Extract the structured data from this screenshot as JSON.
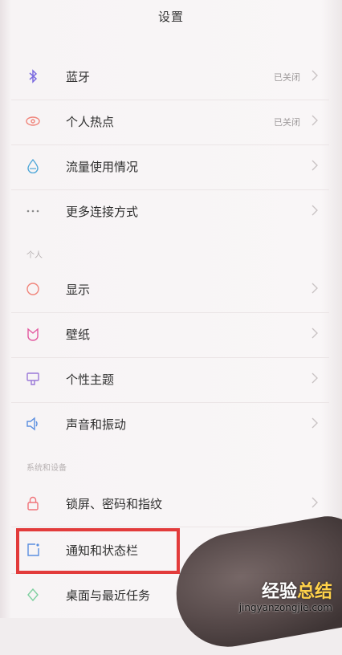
{
  "header": {
    "title": "设置"
  },
  "sections": {
    "personal": "个人",
    "system": "系统和设备"
  },
  "rows": [
    {
      "label": "蓝牙",
      "value": "已关闭",
      "icon": "bluetooth-icon",
      "icon_color": "#7b6be0"
    },
    {
      "label": "个人热点",
      "value": "已关闭",
      "icon": "hotspot-icon",
      "icon_color": "#f0847a"
    },
    {
      "label": "流量使用情况",
      "value": "",
      "icon": "data-usage-icon",
      "icon_color": "#4fa7d8"
    },
    {
      "label": "更多连接方式",
      "value": "",
      "icon": "more-icon",
      "icon_color": "#8a8a8a"
    },
    {
      "label": "显示",
      "value": "",
      "icon": "display-icon",
      "icon_color": "#f0847a"
    },
    {
      "label": "壁纸",
      "value": "",
      "icon": "wallpaper-icon",
      "icon_color": "#e35aa0"
    },
    {
      "label": "个性主题",
      "value": "",
      "icon": "theme-icon",
      "icon_color": "#9a78d8"
    },
    {
      "label": "声音和振动",
      "value": "",
      "icon": "sound-icon",
      "icon_color": "#5b8fe0"
    },
    {
      "label": "锁屏、密码和指纹",
      "value": "",
      "icon": "lock-icon",
      "icon_color": "#f0747a"
    },
    {
      "label": "通知和状态栏",
      "value": "",
      "icon": "notification-icon",
      "icon_color": "#5b8fe0"
    },
    {
      "label": "桌面与最近任务",
      "value": "",
      "icon": "desktop-icon",
      "icon_color": "#7fd0a0"
    }
  ],
  "watermark": {
    "logo_a": "经验",
    "logo_b": "总结",
    "url": "jingyanzongjie.com"
  }
}
